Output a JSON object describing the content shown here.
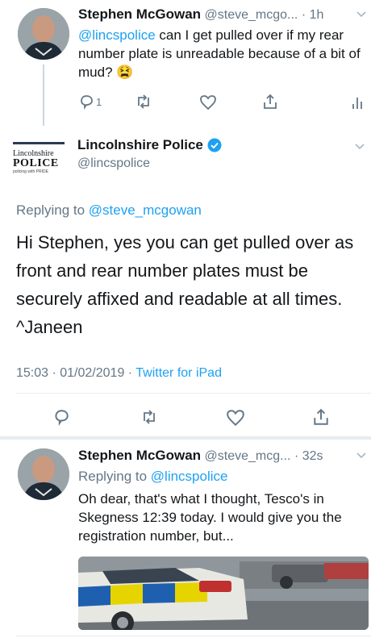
{
  "tweet1": {
    "name": "Stephen McGowan",
    "handle": "@steve_mcgo...",
    "time": "· 1h",
    "mention": "@lincspolice",
    "text_after_mention": " can I get pulled over if my rear number plate is unreadable because of a bit of mud? 😫",
    "reply_count": "1"
  },
  "tweet2": {
    "name": "Lincolnshire Police",
    "handle": "@lincspolice",
    "logo_text": {
      "line1": "Lincolnshire",
      "line2": "POLICE",
      "line3": "policing with PRIDE"
    },
    "replying_prefix": "Replying to ",
    "replying_to": "@steve_mcgowan",
    "text": "Hi Stephen, yes you can get pulled over as front and rear number plates must be securely affixed and readable at all times. ^Janeen",
    "timestamp": "15:03 · 01/02/2019 · ",
    "source": "Twitter for iPad"
  },
  "tweet3": {
    "name": "Stephen McGowan",
    "handle": "@steve_mcg...",
    "time": "· 32s",
    "replying_prefix": "Replying to ",
    "replying_to": "@lincspolice",
    "text": "Oh dear, that's what I thought, Tesco's in Skegness 12:39 today. I would give you the registration number, but..."
  },
  "icons": {
    "reply": "reply-icon",
    "retweet": "retweet-icon",
    "like": "heart-icon",
    "share": "share-icon",
    "analytics": "analytics-icon",
    "verified": "verified-badge-icon",
    "chevron": "chevron-down-icon"
  },
  "colors": {
    "link": "#1da1f2",
    "muted": "#657786",
    "text": "#14171a"
  }
}
